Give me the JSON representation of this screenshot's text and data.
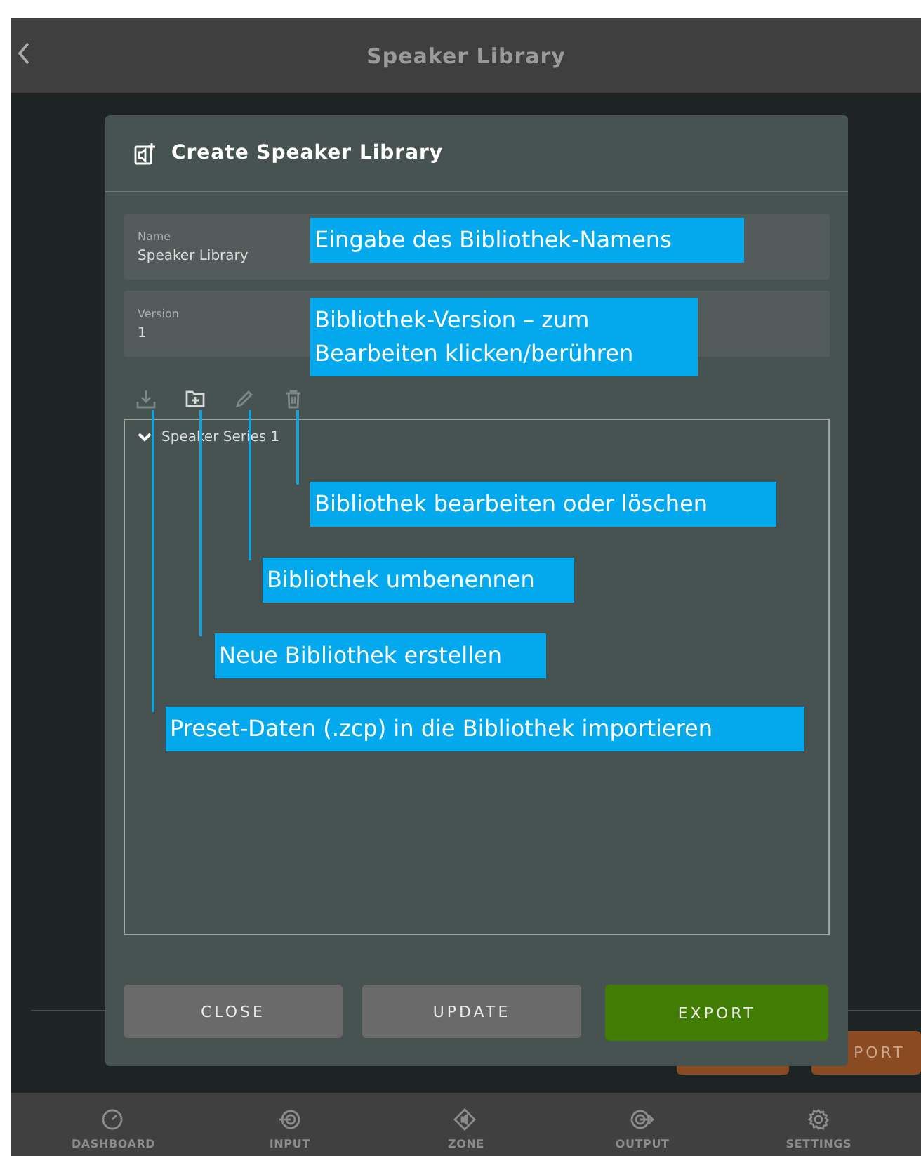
{
  "header": {
    "title": "Speaker Library"
  },
  "background": {
    "buttons": [
      {
        "kind": "orange"
      },
      {
        "label": "PORT",
        "kind": "orange"
      }
    ]
  },
  "dialog": {
    "title": "Create Speaker Library",
    "fields": [
      {
        "label": "Name",
        "value": "Speaker Library"
      },
      {
        "label": "Version",
        "value": "1"
      }
    ],
    "toolbar": [
      {
        "kind": "import",
        "disabled": true
      },
      {
        "kind": "new-folder",
        "disabled": false
      },
      {
        "kind": "rename",
        "disabled": true
      },
      {
        "kind": "delete",
        "disabled": true
      }
    ],
    "tree": {
      "items": [
        {
          "label": "Speaker Series 1",
          "expanded": true
        }
      ]
    },
    "buttons": [
      {
        "label": "CLOSE",
        "kind": "secondary"
      },
      {
        "label": "UPDATE",
        "kind": "secondary"
      },
      {
        "label": "EXPORT",
        "kind": "primary"
      }
    ]
  },
  "annotations": [
    {
      "text": "Eingabe des Bibliothek-Namens"
    },
    {
      "text": "Bibliothek-Version – zum Bearbeiten klicken/berühren"
    },
    {
      "text": "Bibliothek bearbeiten oder löschen"
    },
    {
      "text": "Bibliothek umbenennen"
    },
    {
      "text": "Neue Bibliothek erstellen"
    },
    {
      "text": "Preset-Daten (.zcp) in die Bibliothek importieren"
    }
  ],
  "nav": [
    {
      "label": "DASHBOARD",
      "kind": "dashboard"
    },
    {
      "label": "INPUT",
      "kind": "input"
    },
    {
      "label": "ZONE",
      "kind": "zone"
    },
    {
      "label": "OUTPUT",
      "kind": "output"
    },
    {
      "label": "SETTINGS",
      "kind": "settings"
    }
  ]
}
